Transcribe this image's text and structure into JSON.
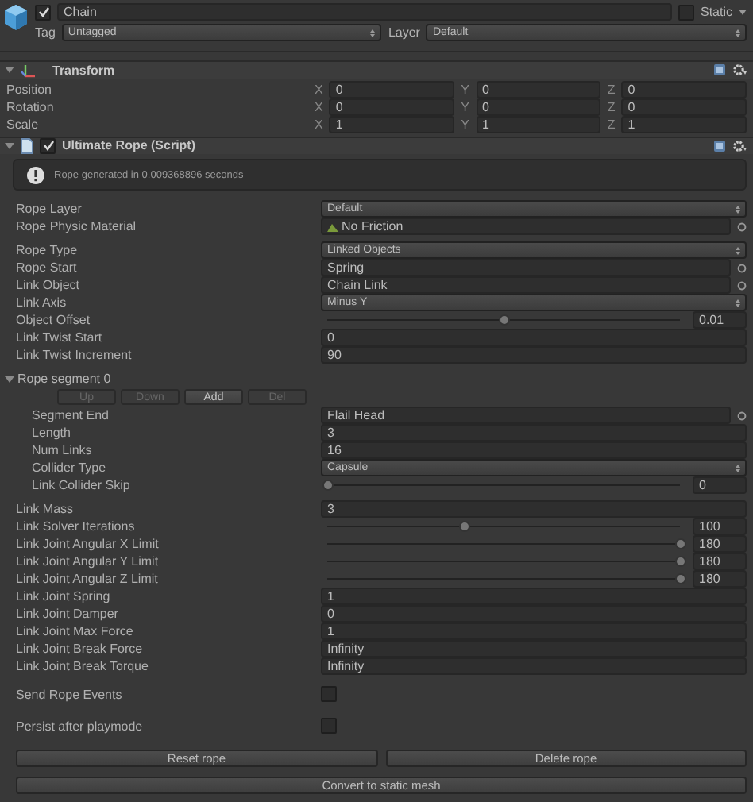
{
  "object": {
    "name": "Chain",
    "active": true,
    "static_label": "Static",
    "static": false,
    "tag_label": "Tag",
    "tag": "Untagged",
    "layer_label": "Layer",
    "layer": "Default"
  },
  "transform": {
    "title": "Transform",
    "expanded": true,
    "rows": [
      {
        "label": "Position",
        "values": [
          {
            "axis": "X",
            "value": "0"
          },
          {
            "axis": "Y",
            "value": "0"
          },
          {
            "axis": "Z",
            "value": "0"
          }
        ]
      },
      {
        "label": "Rotation",
        "values": [
          {
            "axis": "X",
            "value": "0"
          },
          {
            "axis": "Y",
            "value": "0"
          },
          {
            "axis": "Z",
            "value": "0"
          }
        ]
      },
      {
        "label": "Scale",
        "values": [
          {
            "axis": "X",
            "value": "1"
          },
          {
            "axis": "Y",
            "value": "1"
          },
          {
            "axis": "Z",
            "value": "1"
          }
        ]
      }
    ]
  },
  "script": {
    "title": "Ultimate Rope (Script)",
    "enabled": true,
    "expanded": true,
    "info": "Rope generated in 0.009368896 seconds",
    "sections": [
      {
        "kind": "fields",
        "fields": [
          {
            "kind": "dropdown",
            "label": "Rope Layer",
            "value": "Default"
          },
          {
            "kind": "asset",
            "label": "Rope Physic Material",
            "value": "No Friction"
          }
        ]
      },
      {
        "kind": "fields",
        "fields": [
          {
            "kind": "dropdown",
            "label": "Rope Type",
            "value": "Linked Objects"
          },
          {
            "kind": "object",
            "label": "Rope Start",
            "value": "Spring"
          },
          {
            "kind": "object",
            "label": "Link Object",
            "value": "Chain Link"
          },
          {
            "kind": "dropdown",
            "label": "Link Axis",
            "value": "Minus Y"
          },
          {
            "kind": "slider",
            "label": "Object Offset",
            "level": 0.5,
            "value": "0.01"
          },
          {
            "kind": "text",
            "label": "Link Twist Start",
            "value": "0"
          },
          {
            "kind": "text",
            "label": "Link Twist Increment",
            "value": "90"
          }
        ]
      },
      {
        "kind": "segment",
        "title": "Rope segment 0",
        "expanded": true,
        "buttons": [
          {
            "label": "Up",
            "disabled": true
          },
          {
            "label": "Down",
            "disabled": true
          },
          {
            "label": "Add",
            "disabled": false
          },
          {
            "label": "Del",
            "disabled": true
          }
        ],
        "fields": [
          {
            "kind": "object",
            "label": "Segment End",
            "value": "Flail Head"
          },
          {
            "kind": "text",
            "label": "Length",
            "value": "3"
          },
          {
            "kind": "text",
            "label": "Num Links",
            "value": "16"
          },
          {
            "kind": "dropdown",
            "label": "Collider Type",
            "value": "Capsule"
          },
          {
            "kind": "slider",
            "label": "Link Collider Skip",
            "level": 0,
            "value": "0"
          }
        ]
      },
      {
        "kind": "fields",
        "fields": [
          {
            "kind": "text",
            "label": "Link Mass",
            "value": "3"
          },
          {
            "kind": "slider",
            "label": "Link Solver Iterations",
            "level": 0.39,
            "value": "100"
          },
          {
            "kind": "slider",
            "label": "Link Joint Angular X Limit",
            "level": 1,
            "value": "180"
          },
          {
            "kind": "slider",
            "label": "Link Joint Angular Y Limit",
            "level": 1,
            "value": "180"
          },
          {
            "kind": "slider",
            "label": "Link Joint Angular Z Limit",
            "level": 1,
            "value": "180"
          },
          {
            "kind": "text",
            "label": "Link Joint Spring",
            "value": "1"
          },
          {
            "kind": "text",
            "label": "Link Joint Damper",
            "value": "0"
          },
          {
            "kind": "text",
            "label": "Link Joint Max Force",
            "value": "1"
          },
          {
            "kind": "text",
            "label": "Link Joint Break Force",
            "value": "Infinity"
          },
          {
            "kind": "text",
            "label": "Link Joint Break Torque",
            "value": "Infinity"
          }
        ]
      },
      {
        "kind": "fields",
        "fields": [
          {
            "kind": "checkbox",
            "label": "Send Rope Events",
            "checked": false
          }
        ]
      },
      {
        "kind": "fields",
        "fields": [
          {
            "kind": "checkbox",
            "label": "Persist after playmode",
            "checked": false
          }
        ]
      }
    ],
    "actions": [
      [
        "Reset rope",
        "Delete rope"
      ],
      [
        "Convert to static mesh"
      ]
    ]
  }
}
